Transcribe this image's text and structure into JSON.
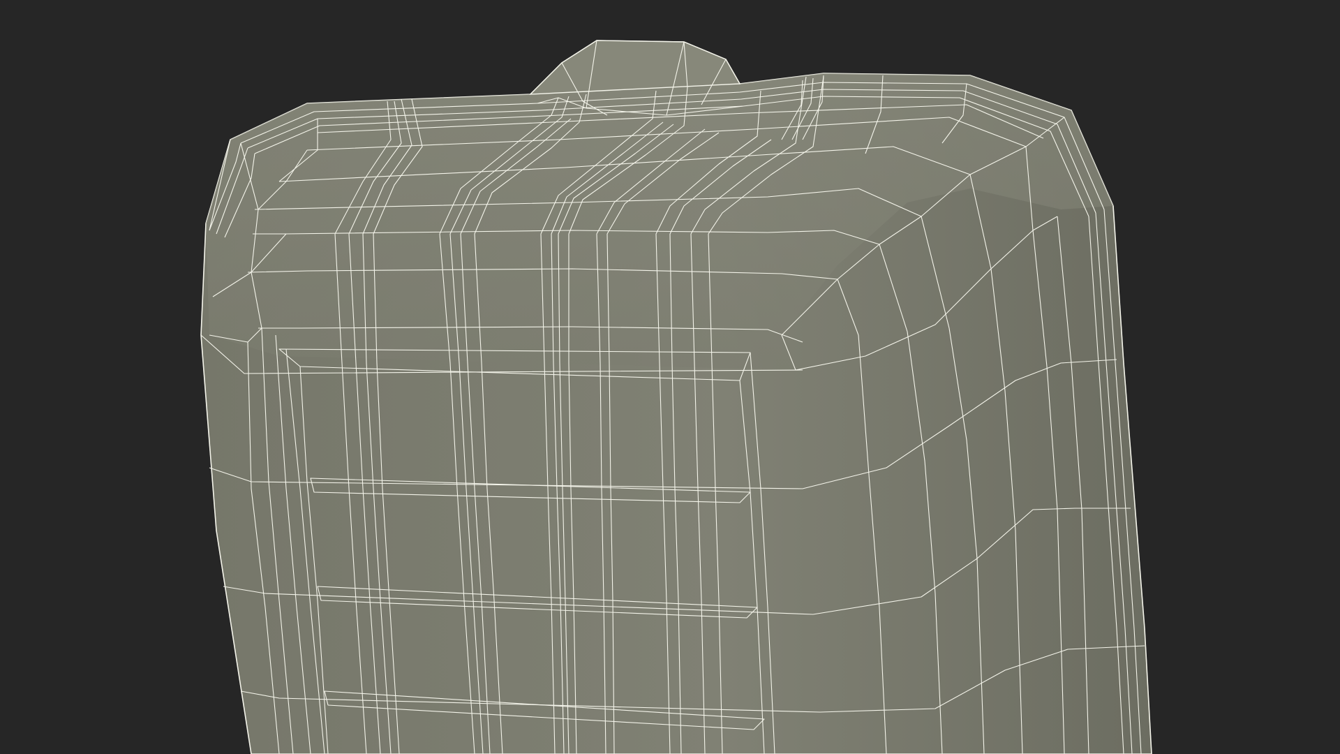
{
  "scene": {
    "background_color": "#262626",
    "surface_color": "#7e7f71",
    "surface_shade_color": "#6f7064",
    "wire_color": "#f4f4ea",
    "subject": "wireframe-mesh-render"
  }
}
